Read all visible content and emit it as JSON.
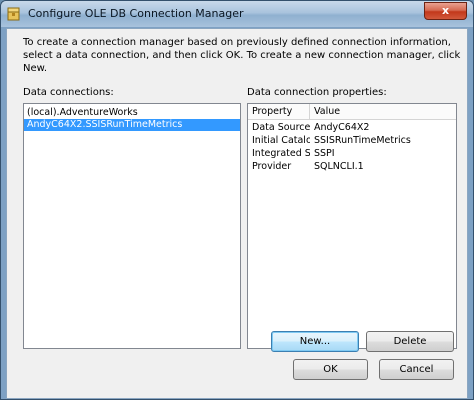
{
  "window": {
    "title": "Configure OLE DB Connection Manager",
    "close_label": "x",
    "colors": {
      "titlebar": "#a9c3dd",
      "selection": "#3399ff",
      "close": "#c2381b"
    },
    "icons": {
      "app": "ssis-package-icon",
      "close": "close-icon"
    }
  },
  "instructions": "To create a connection manager based on previously defined connection information, select a data connection, and then click OK. To create a new connection manager, click New.",
  "data_connections": {
    "label": "Data connections:",
    "items": [
      {
        "label": "(local).AdventureWorks",
        "selected": false
      },
      {
        "label": "AndyC64X2.SSISRunTimeMetrics",
        "selected": true
      }
    ]
  },
  "properties": {
    "label": "Data connection properties:",
    "columns": [
      "Property",
      "Value"
    ],
    "rows": [
      {
        "property": "Data Source",
        "value": "AndyC64X2"
      },
      {
        "property": "Initial Catalog",
        "value": "SSISRunTimeMetrics"
      },
      {
        "property": "Integrated Se...",
        "value": "SSPI"
      },
      {
        "property": "Provider",
        "value": "SQLNCLI.1"
      }
    ]
  },
  "buttons": {
    "new": "New...",
    "delete": "Delete",
    "ok": "OK",
    "cancel": "Cancel"
  }
}
